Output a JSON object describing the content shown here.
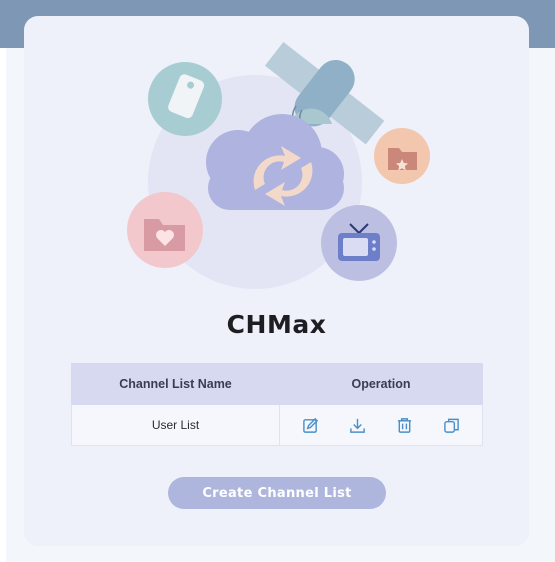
{
  "app": {
    "title": "CHMax"
  },
  "illustration": {
    "icons": [
      "tag-icon",
      "satellite-icon",
      "cloud-sync-icon",
      "folder-star-icon",
      "folder-heart-icon",
      "tv-icon"
    ]
  },
  "table": {
    "headers": [
      "Channel List Name",
      "Operation"
    ],
    "rows": [
      {
        "name": "User List",
        "operations": [
          "edit-icon",
          "download-icon",
          "delete-icon",
          "copy-icon"
        ]
      }
    ]
  },
  "create_button": {
    "label": "Create Channel List"
  },
  "colors": {
    "topbar": "#7d97b5",
    "card_background": "#eef0fa",
    "table_header": "#d6d9ef",
    "accent_icon": "#4a8fc9",
    "button": "#aeb6de"
  }
}
